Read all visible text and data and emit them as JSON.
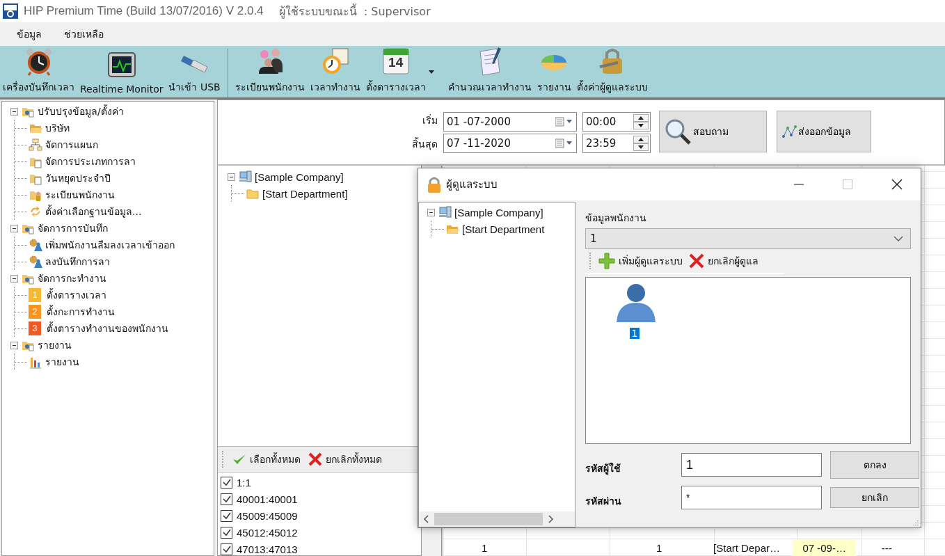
{
  "window": {
    "title": "HIP Premium Time (Build 13/07/2016) V 2.0.4",
    "current_user": "ผู้ใช้ระบบขณะนี้  : Supervisor"
  },
  "menu": [
    "ข้อมูล",
    "ช่วยเหลือ"
  ],
  "toolbar": [
    {
      "kind": "alarm",
      "label": "เครื่องบันทึกเวลา"
    },
    {
      "kind": "monitor",
      "label": "Realtime Monitor"
    },
    {
      "kind": "usb",
      "label": "นำเข้า USB"
    },
    {
      "kind": "separator"
    },
    {
      "kind": "people",
      "label": "ระเบียนพนักงาน"
    },
    {
      "kind": "clock",
      "label": "เวลาทำงาน"
    },
    {
      "kind": "calendar",
      "label": "ตั้งตารางเวลา",
      "icon_text": "14",
      "dropdown": true
    },
    {
      "kind": "document",
      "label": "คำนวณเวลาทำงาน"
    },
    {
      "kind": "pie",
      "label": "รายงาน"
    },
    {
      "kind": "lock",
      "label": "ตั้งค่าผู้ดูแลระบบ"
    }
  ],
  "sidebar": {
    "items": [
      {
        "kind": "group",
        "label": "ปรับปรุงข้อมูล/ตั้งค่า",
        "expanded": true,
        "children": [
          {
            "kind": "folder-open",
            "label": "บริษัท"
          },
          {
            "kind": "org",
            "label": "จัดการแผนก"
          },
          {
            "kind": "folder-doc",
            "label": "จัดการประเภทการลา"
          },
          {
            "kind": "folder-doc",
            "label": "วันหยุดประจำปี"
          },
          {
            "kind": "folder-person",
            "label": "ระเบียนพนักงาน"
          },
          {
            "kind": "arrows",
            "label": "ตั้งค่าเลือกฐานข้อมูล..."
          }
        ]
      },
      {
        "kind": "group",
        "label": "จัดการการบันทึก",
        "expanded": true,
        "children": [
          {
            "kind": "gear",
            "label": "เพิ่มพนักงานลืมลงเวลาเข้าออก"
          },
          {
            "kind": "gear",
            "label": "ลงบันทึกการลา"
          }
        ]
      },
      {
        "kind": "group",
        "label": "จัดการกะทำงาน",
        "expanded": true,
        "children": [
          {
            "kind": "badge",
            "badge": "1",
            "color": "#f9b731",
            "label": "ตั้งตารางเวลา"
          },
          {
            "kind": "badge",
            "badge": "2",
            "color": "#f7941d",
            "label": "ตั้งกะการทำงาน"
          },
          {
            "kind": "badge",
            "badge": "3",
            "color": "#f15a24",
            "label": "ตั้งตารางทำงานของพนักงาน"
          }
        ]
      },
      {
        "kind": "group",
        "label": "รายงาน",
        "expanded": true,
        "children": [
          {
            "kind": "chart",
            "label": "รายงาน"
          }
        ]
      }
    ]
  },
  "filter": {
    "start_label": "เริ่ม",
    "start_date": "01 -07-2000",
    "start_time": "00:00",
    "end_label": "สิ้นสุด",
    "end_date": "07 -11-2020",
    "end_time": "23:59",
    "query_button": "สอบถาม",
    "export_button": "ส่งออกข้อมูล"
  },
  "department_tree": [
    {
      "kind": "company",
      "label": "[Sample Company]",
      "expanded": true,
      "children": [
        {
          "kind": "folder",
          "label": "[Start Department]"
        }
      ]
    }
  ],
  "employee_toolbar": {
    "select_all": "เลือกทั้งหมด",
    "deselect_all": "ยกเลิกทั้งหมด"
  },
  "employees": [
    {
      "label": "1:1",
      "checked": true
    },
    {
      "label": "40001:40001",
      "checked": true
    },
    {
      "label": "45009:45009",
      "checked": true
    },
    {
      "label": "45012:45012",
      "checked": true
    },
    {
      "label": "47013:47013",
      "checked": true
    }
  ],
  "table": {
    "rows": [
      {
        "column_1": "1",
        "column_3": "1",
        "column_4": "[Start Depar…",
        "column_5": "07 -09-…",
        "column_6": "---"
      }
    ]
  },
  "dialog": {
    "title": "ผู้ดูแลระบบ",
    "tree": [
      {
        "kind": "company",
        "label": "[Sample Company]",
        "expanded": true,
        "children": [
          {
            "kind": "folder-open",
            "label": "[Start Department"
          }
        ]
      }
    ],
    "employee_label": "ข้อมูลพนักงาน",
    "employee_value": "1",
    "add_button": "เพิ่มผู้ดูแลระบบ",
    "remove_button": "ยกเลิกผู้ดูแล",
    "admins": [
      {
        "label": "1",
        "selected": true
      }
    ],
    "user_label": "รหัสผู้ใช้",
    "user_value": "1",
    "password_label": "รหัสผ่าน",
    "password_value": "*",
    "ok_button": "ตกลง",
    "cancel_button": "ยกเลิก"
  }
}
